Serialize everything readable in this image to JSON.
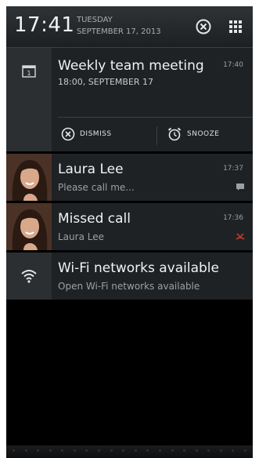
{
  "header": {
    "time": "17:41",
    "day_of_week": "TUESDAY",
    "date": "SEPTEMBER 17, 2013",
    "clear_icon": "clear-all-icon",
    "settings_icon": "quick-settings-grid-icon"
  },
  "notifications": {
    "meeting": {
      "title": "Weekly team meeting",
      "subtitle": "18:00, SEPTEMBER 17",
      "time": "17:40",
      "icon": "calendar-icon",
      "actions": {
        "dismiss": "DISMISS",
        "snooze": "SNOOZE"
      }
    },
    "message": {
      "title": "Laura Lee",
      "subtitle": "Please call me...",
      "time": "17:37",
      "icon": "message-icon"
    },
    "missed_call": {
      "title": "Missed call",
      "subtitle": "Laura Lee",
      "time": "17:36",
      "icon": "missed-call-icon"
    },
    "wifi": {
      "title": "Wi-Fi networks available",
      "subtitle": "Open Wi-Fi networks available",
      "icon": "wifi-icon"
    }
  },
  "colors": {
    "background": "#000000",
    "notification_bg": "#1f2224",
    "icon_column_bg": "#2b2f32",
    "missed_call_red": "#c0392b"
  }
}
